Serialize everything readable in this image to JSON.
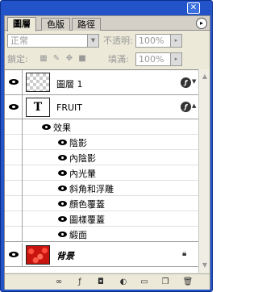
{
  "tabs": [
    {
      "label": "圖層",
      "active": true
    },
    {
      "label": "色版",
      "active": false
    },
    {
      "label": "路徑",
      "active": false
    }
  ],
  "blend_mode": "正常",
  "opacity_label": "不透明:",
  "opacity_value": "100%",
  "lock_label": "鎖定:",
  "fill_label": "填滿:",
  "fill_value": "100%",
  "layers": {
    "layer1": {
      "name": "圖層 1"
    },
    "fruit": {
      "name": "FRUIT",
      "thumb_glyph": "T"
    },
    "effects_header": "效果",
    "effects": [
      "陰影",
      "內陰影",
      "內光暈",
      "斜角和浮雕",
      "顏色覆蓋",
      "圖樣覆蓋",
      "緞面"
    ],
    "background": {
      "name": "背景"
    }
  }
}
